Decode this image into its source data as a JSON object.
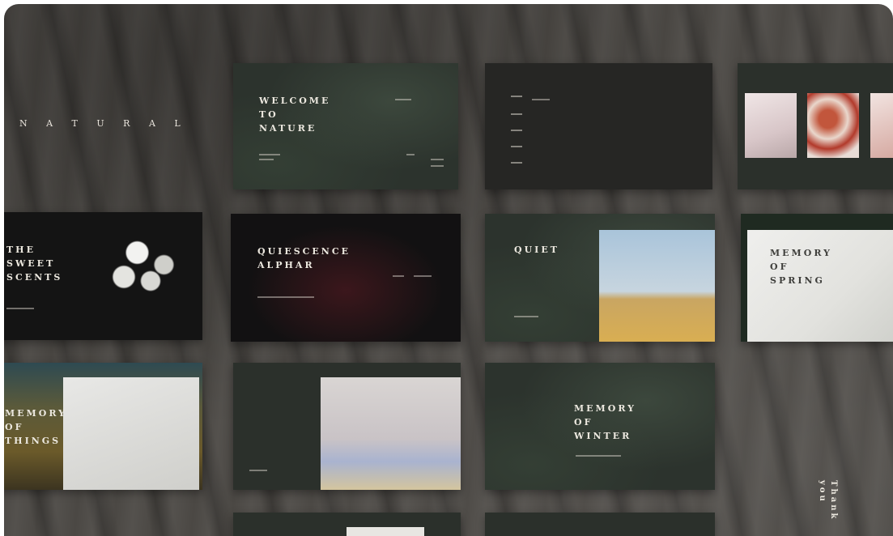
{
  "brand": {
    "name": "N A T U R A L"
  },
  "slides": {
    "welcome": {
      "title": "WELCOME\nTO\nNATURE"
    },
    "sweet": {
      "title": "THE\nSWEET\nSCENTS"
    },
    "quote": {
      "title": "QUIESCENCE\nALPHAR"
    },
    "quiet": {
      "title": "QUIET"
    },
    "spring": {
      "title": "MEMORY\nOF\nSPRING"
    },
    "memory_left": {
      "title": "MEMORY\nOF\nTHINGS"
    },
    "memory_center": {
      "title": "MEMORY\nOF\nWINTER"
    }
  },
  "footer": {
    "thanks": "Thank you"
  },
  "colors": {
    "background": "#4b4844",
    "slide_green": "#2b302b",
    "slide_black": "#141414",
    "text_light": "#ece8df"
  }
}
